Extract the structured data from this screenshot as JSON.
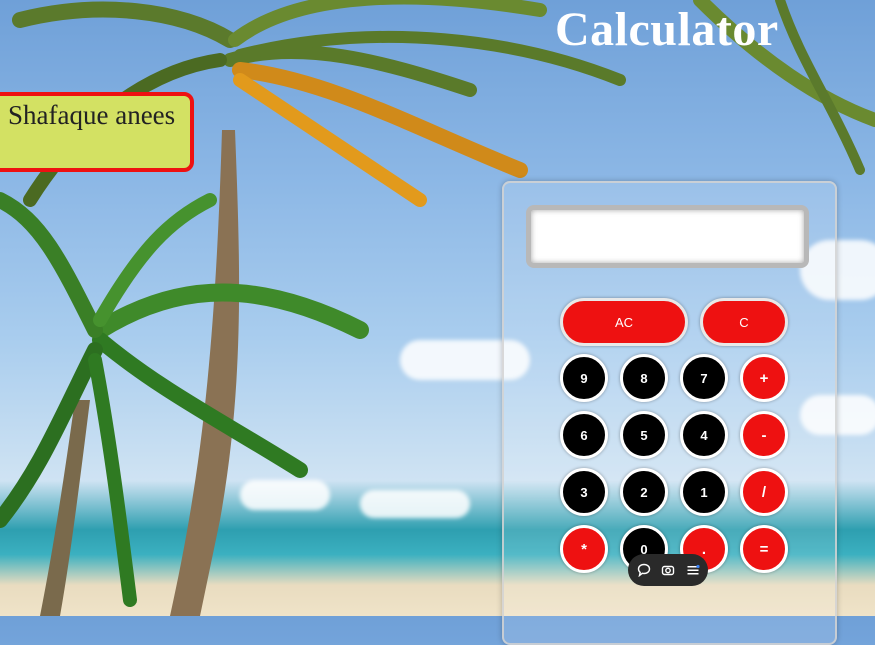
{
  "app": {
    "title": "Calculator",
    "author": "Shafaque anees"
  },
  "display": {
    "value": ""
  },
  "buttons": {
    "ac": "AC",
    "c": "C",
    "row1": [
      "9",
      "8",
      "7",
      "+"
    ],
    "row2": [
      "6",
      "5",
      "4",
      "-"
    ],
    "row3": [
      "3",
      "2",
      "1",
      "/"
    ],
    "row4": [
      "*",
      "0",
      ".",
      "="
    ]
  },
  "toolbar": {
    "icons": [
      "chat-icon",
      "camera-icon",
      "menu-icon"
    ]
  },
  "colors": {
    "accent_red": "#ee1111",
    "digit_black": "#000000",
    "name_card": "#d3e163"
  }
}
